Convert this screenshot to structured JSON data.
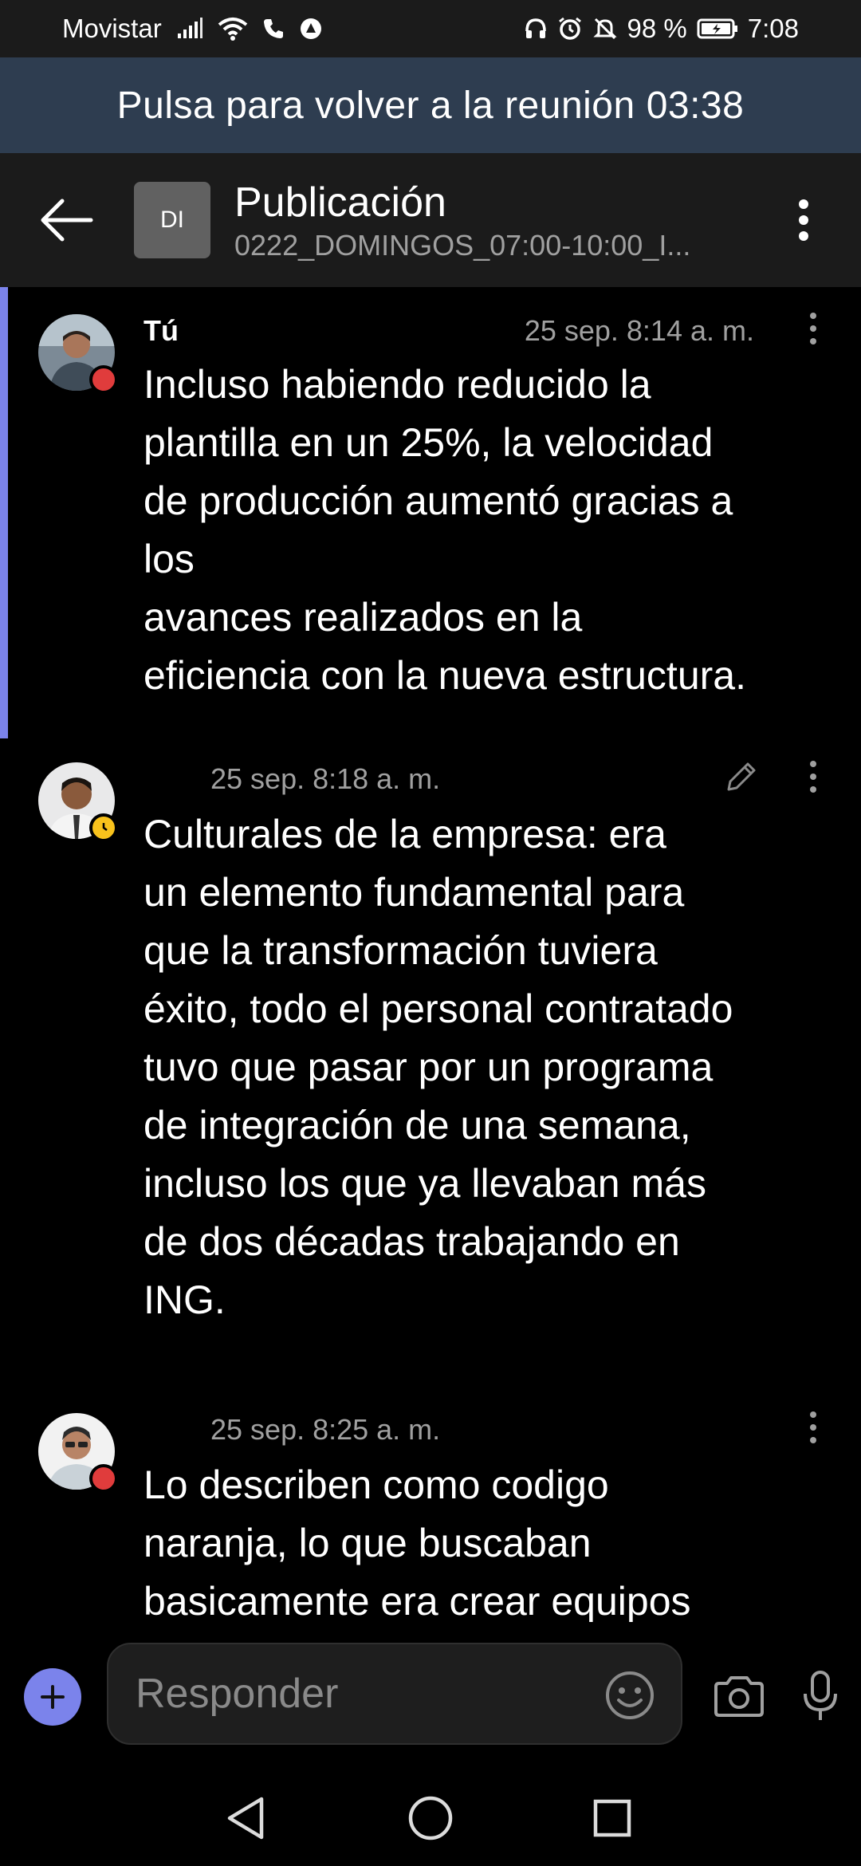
{
  "status_bar": {
    "carrier": "Movistar",
    "battery": "98 %",
    "time": "7:08"
  },
  "banner": {
    "text": "Pulsa para volver a la reunión",
    "timer": "03:38",
    "color": "#2e3d50"
  },
  "header": {
    "avatar_initials": "DI",
    "title": "Publicación",
    "subtitle": "0222_DOMINGOS_07:00-10:00_I..."
  },
  "messages": [
    {
      "sender": "Tú",
      "timestamp": "25 sep. 8:14 a. m.",
      "presence": "busy",
      "selected": true,
      "text": "Incluso habiendo reducido la\nplantilla en un 25%, la velocidad\nde producción aumentó gracias a\nlos\navances realizados en la\neficiencia con la nueva estructura."
    },
    {
      "sender": "",
      "timestamp": "25 sep. 8:18 a. m.",
      "presence": "away",
      "edited": true,
      "text": "Culturales de la empresa: era\nun elemento fundamental para\nque la transformación tuviera\néxito, todo el personal contratado\ntuvo que pasar por un programa\nde integración de una semana,\nincluso los que ya llevaban más\nde dos décadas trabajando en\nING."
    },
    {
      "sender": "",
      "timestamp": "25 sep. 8:25 a. m.",
      "presence": "busy",
      "text": "Lo describen como codigo\nnaranja, lo que buscaban\nbasicamente era crear equipos"
    }
  ],
  "composer": {
    "placeholder": "Responder"
  },
  "colors": {
    "accent": "#7b83eb",
    "presence_busy": "#e03c3c",
    "presence_away": "#f8c21c"
  },
  "icons": [
    "back-arrow-icon",
    "more-vertical-icon",
    "pencil-icon",
    "plus-icon",
    "emoji-icon",
    "camera-icon",
    "mic-icon",
    "nav-back-icon",
    "nav-home-icon",
    "nav-recents-icon"
  ]
}
